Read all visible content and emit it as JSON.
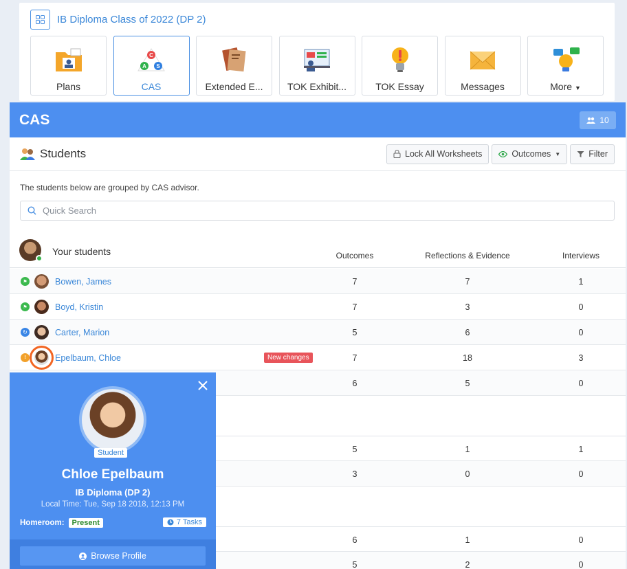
{
  "class_title": "IB Diploma Class of 2022 (DP 2)",
  "tabs": [
    {
      "label": "Plans",
      "icon": "plans-folder-icon"
    },
    {
      "label": "CAS",
      "icon": "cas-triangle-icon",
      "active": true
    },
    {
      "label": "Extended E...",
      "icon": "extended-essay-book-icon"
    },
    {
      "label": "TOK Exhibit...",
      "icon": "tok-exhibition-icon"
    },
    {
      "label": "TOK Essay",
      "icon": "lightbulb-icon"
    },
    {
      "label": "Messages",
      "icon": "envelope-icon"
    },
    {
      "label": "More",
      "icon": "more-apps-icon"
    }
  ],
  "panel": {
    "title": "CAS",
    "student_count": "10"
  },
  "students_bar": {
    "title": "Students",
    "lock_label": "Lock All Worksheets",
    "outcomes_label": "Outcomes",
    "filter_label": "Filter"
  },
  "note": "The students below are grouped by CAS advisor.",
  "search": {
    "placeholder": "Quick Search"
  },
  "group": {
    "name": "Your students"
  },
  "columns": {
    "outcomes": "Outcomes",
    "reflections": "Reflections & Evidence",
    "interviews": "Interviews"
  },
  "rows": [
    {
      "name": "Bowen, James",
      "outcomes": "7",
      "reflections": "7",
      "interviews": "1"
    },
    {
      "name": "Boyd, Kristin",
      "outcomes": "7",
      "reflections": "3",
      "interviews": "0"
    },
    {
      "name": "Carter, Marion",
      "outcomes": "5",
      "reflections": "6",
      "interviews": "0"
    },
    {
      "name": "Epelbaum, Chloe",
      "badge": "New changes",
      "outcomes": "7",
      "reflections": "18",
      "interviews": "3"
    },
    {
      "name": "",
      "outcomes": "6",
      "reflections": "5",
      "interviews": "0"
    },
    {
      "name": "",
      "outcomes": "5",
      "reflections": "1",
      "interviews": "1"
    },
    {
      "name": "",
      "outcomes": "3",
      "reflections": "0",
      "interviews": "0"
    },
    {
      "name": "",
      "outcomes": "6",
      "reflections": "1",
      "interviews": "0"
    },
    {
      "name": "",
      "outcomes": "5",
      "reflections": "2",
      "interviews": "0"
    }
  ],
  "popover": {
    "role": "Student",
    "name": "Chloe Epelbaum",
    "program": "IB Diploma (DP 2)",
    "local_time": "Local Time: Tue, Sep 18 2018, 12:13 PM",
    "homeroom_label": "Homeroom:",
    "homeroom_status": "Present",
    "tasks": "7 Tasks",
    "browse_label": "Browse Profile"
  },
  "colors": {
    "accent": "#4d8ff0",
    "link": "#3a87d8",
    "badge_red": "#e8545a",
    "highlight": "#f26522"
  }
}
